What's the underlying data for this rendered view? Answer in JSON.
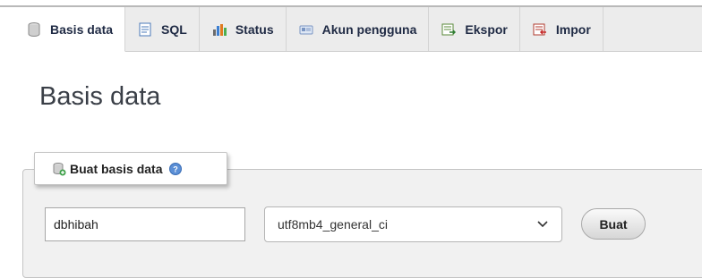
{
  "tabs": [
    {
      "label": "Basis data",
      "icon": "database-icon",
      "active": true
    },
    {
      "label": "SQL",
      "icon": "sql-icon",
      "active": false
    },
    {
      "label": "Status",
      "icon": "status-icon",
      "active": false
    },
    {
      "label": "Akun pengguna",
      "icon": "user-accounts-icon",
      "active": false
    },
    {
      "label": "Ekspor",
      "icon": "export-icon",
      "active": false
    },
    {
      "label": "Impor",
      "icon": "import-icon",
      "active": false
    }
  ],
  "page": {
    "title": "Basis data"
  },
  "create_db": {
    "legend": "Buat basis data",
    "name_value": "dbhibah",
    "collation_selected": "utf8mb4_general_ci",
    "button_label": "Buat"
  }
}
